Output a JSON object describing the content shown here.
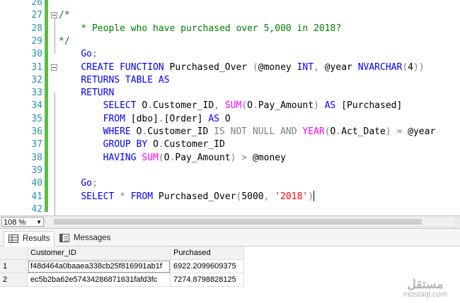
{
  "editor": {
    "lines": [
      {
        "n": "26",
        "segs": []
      },
      {
        "n": "27",
        "fold": true,
        "segs": [
          {
            "c": "cm",
            "t": "/*"
          }
        ]
      },
      {
        "n": "28",
        "segs": [
          {
            "c": "cm",
            "t": "    * People who have purchased over 5,000 in 2018?"
          }
        ]
      },
      {
        "n": "29",
        "segs": [
          {
            "c": "cm",
            "t": "*/"
          }
        ]
      },
      {
        "n": "30",
        "segs": [
          {
            "c": "tx",
            "t": "    "
          },
          {
            "c": "kw",
            "t": "Go"
          },
          {
            "c": "gr",
            "t": ";"
          }
        ]
      },
      {
        "n": "31",
        "fold": true,
        "segs": [
          {
            "c": "tx",
            "t": "    "
          },
          {
            "c": "kw",
            "t": "CREATE FUNCTION"
          },
          {
            "c": "tx",
            "t": " Purchased_Over "
          },
          {
            "c": "gr",
            "t": "("
          },
          {
            "c": "tx",
            "t": "@money "
          },
          {
            "c": "kw",
            "t": "INT"
          },
          {
            "c": "gr",
            "t": ","
          },
          {
            "c": "tx",
            "t": " @year "
          },
          {
            "c": "kw",
            "t": "NVARCHAR"
          },
          {
            "c": "gr",
            "t": "("
          },
          {
            "c": "tx",
            "t": "4"
          },
          {
            "c": "gr",
            "t": "))"
          }
        ]
      },
      {
        "n": "32",
        "segs": [
          {
            "c": "tx",
            "t": "    "
          },
          {
            "c": "kw",
            "t": "RETURNS TABLE AS"
          }
        ]
      },
      {
        "n": "33",
        "segs": [
          {
            "c": "tx",
            "t": "    "
          },
          {
            "c": "kw",
            "t": "RETURN"
          }
        ]
      },
      {
        "n": "34",
        "segs": [
          {
            "c": "tx",
            "t": "        "
          },
          {
            "c": "kw",
            "t": "SELECT"
          },
          {
            "c": "tx",
            "t": " O"
          },
          {
            "c": "gr",
            "t": "."
          },
          {
            "c": "tx",
            "t": "Customer_ID"
          },
          {
            "c": "gr",
            "t": ","
          },
          {
            "c": "tx",
            "t": " "
          },
          {
            "c": "fn",
            "t": "SUM"
          },
          {
            "c": "gr",
            "t": "("
          },
          {
            "c": "tx",
            "t": "O"
          },
          {
            "c": "gr",
            "t": "."
          },
          {
            "c": "tx",
            "t": "Pay_Amount"
          },
          {
            "c": "gr",
            "t": ")"
          },
          {
            "c": "tx",
            "t": " "
          },
          {
            "c": "kw",
            "t": "AS"
          },
          {
            "c": "tx",
            "t": " [Purchased]"
          }
        ]
      },
      {
        "n": "35",
        "segs": [
          {
            "c": "tx",
            "t": "        "
          },
          {
            "c": "kw",
            "t": "FROM"
          },
          {
            "c": "tx",
            "t": " [dbo]"
          },
          {
            "c": "gr",
            "t": "."
          },
          {
            "c": "tx",
            "t": "[Order] "
          },
          {
            "c": "kw",
            "t": "AS"
          },
          {
            "c": "tx",
            "t": " O"
          }
        ]
      },
      {
        "n": "36",
        "segs": [
          {
            "c": "tx",
            "t": "        "
          },
          {
            "c": "kw",
            "t": "WHERE"
          },
          {
            "c": "tx",
            "t": " O"
          },
          {
            "c": "gr",
            "t": "."
          },
          {
            "c": "tx",
            "t": "Customer_ID "
          },
          {
            "c": "gr",
            "t": "IS NOT NULL AND"
          },
          {
            "c": "tx",
            "t": " "
          },
          {
            "c": "fn",
            "t": "YEAR"
          },
          {
            "c": "gr",
            "t": "("
          },
          {
            "c": "tx",
            "t": "O"
          },
          {
            "c": "gr",
            "t": "."
          },
          {
            "c": "tx",
            "t": "Act_Date"
          },
          {
            "c": "gr",
            "t": ")"
          },
          {
            "c": "tx",
            "t": " "
          },
          {
            "c": "gr",
            "t": "="
          },
          {
            "c": "tx",
            "t": " @year"
          }
        ]
      },
      {
        "n": "37",
        "segs": [
          {
            "c": "tx",
            "t": "        "
          },
          {
            "c": "kw",
            "t": "GROUP BY"
          },
          {
            "c": "tx",
            "t": " O"
          },
          {
            "c": "gr",
            "t": "."
          },
          {
            "c": "tx",
            "t": "Customer_ID"
          }
        ]
      },
      {
        "n": "38",
        "segs": [
          {
            "c": "tx",
            "t": "        "
          },
          {
            "c": "kw",
            "t": "HAVING"
          },
          {
            "c": "tx",
            "t": " "
          },
          {
            "c": "fn",
            "t": "SUM"
          },
          {
            "c": "gr",
            "t": "("
          },
          {
            "c": "tx",
            "t": "O"
          },
          {
            "c": "gr",
            "t": "."
          },
          {
            "c": "tx",
            "t": "Pay_Amount"
          },
          {
            "c": "gr",
            "t": ")"
          },
          {
            "c": "tx",
            "t": " "
          },
          {
            "c": "gr",
            "t": ">"
          },
          {
            "c": "tx",
            "t": " @money"
          }
        ]
      },
      {
        "n": "39",
        "segs": []
      },
      {
        "n": "40",
        "segs": [
          {
            "c": "tx",
            "t": "    "
          },
          {
            "c": "kw",
            "t": "Go"
          },
          {
            "c": "gr",
            "t": ";"
          }
        ]
      },
      {
        "n": "41",
        "caret": true,
        "segs": [
          {
            "c": "tx",
            "t": "    "
          },
          {
            "c": "kw",
            "t": "SELECT"
          },
          {
            "c": "tx",
            "t": " "
          },
          {
            "c": "gr",
            "t": "*"
          },
          {
            "c": "tx",
            "t": " "
          },
          {
            "c": "kw",
            "t": "FROM"
          },
          {
            "c": "tx",
            "t": " Purchased_Over"
          },
          {
            "c": "gr",
            "t": "("
          },
          {
            "c": "tx",
            "t": "5000"
          },
          {
            "c": "gr",
            "t": ","
          },
          {
            "c": "tx",
            "t": " "
          },
          {
            "c": "str",
            "t": "'2018'"
          },
          {
            "c": "gr",
            "t": ")"
          }
        ]
      },
      {
        "n": "42",
        "segs": []
      }
    ]
  },
  "statusbar": {
    "zoom": "108 %"
  },
  "tabs": [
    {
      "label": "Results",
      "icon": "grid-icon",
      "active": true
    },
    {
      "label": "Messages",
      "icon": "messages-icon",
      "active": false
    }
  ],
  "results": {
    "columns": [
      "Customer_ID",
      "Purchased"
    ],
    "rows": [
      {
        "num": "1",
        "cells": [
          "f48d464a0baaea338cb25f816991ab1f",
          "6922.2099609375"
        ]
      },
      {
        "num": "2",
        "cells": [
          "ec5b2ba62e57434286871631fafd3fc",
          "7274.8798828125"
        ]
      }
    ]
  },
  "watermark": {
    "top": "مستقل",
    "bottom": "mostaql.com"
  },
  "colors": {
    "keyword": "#0000ff",
    "function": "#ff00ff",
    "comment": "#008000",
    "string": "#ff0000",
    "operator": "#808080",
    "line_number": "#2b91af",
    "change_bar": "#5bbd45"
  }
}
